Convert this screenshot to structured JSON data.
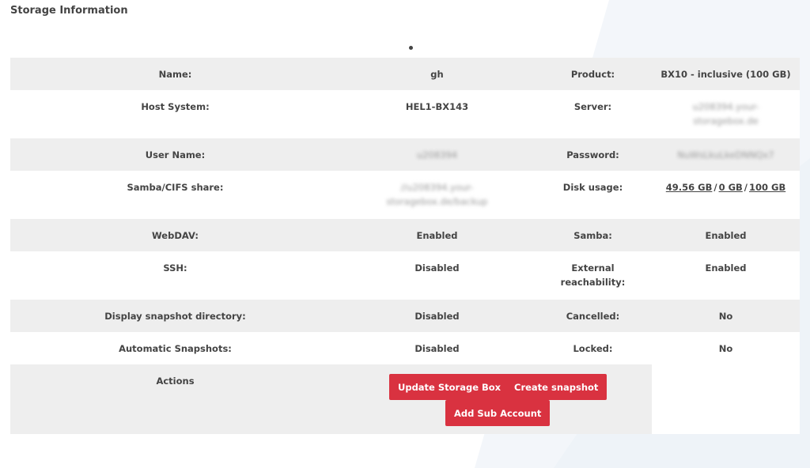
{
  "section_title": "Storage Information",
  "rows": [
    {
      "label1": "Name:",
      "value1": "gh",
      "label2": "Product:",
      "value2": "BX10 - inclusive (100 GB)"
    },
    {
      "label1": "Host System:",
      "value1": "HEL1-BX143",
      "label2": "Server:",
      "value2": "u208394.your-storagebox.de"
    },
    {
      "label1": "User Name:",
      "value1": "u208394",
      "label2": "Password:",
      "value2": "NuWsLkuLkeDNNQx7"
    },
    {
      "label1": "Samba/CIFS share:",
      "value1": "//u208394.your-storagebox.de/backup",
      "label2": "Disk usage:",
      "value2": ""
    },
    {
      "label1": "WebDAV:",
      "value1": "Enabled",
      "label2": "Samba:",
      "value2": "Enabled"
    },
    {
      "label1": "SSH:",
      "value1": "Disabled",
      "label2": "External reachability:",
      "value2": "Enabled"
    },
    {
      "label1": "Display snapshot directory:",
      "value1": "Disabled",
      "label2": "Cancelled:",
      "value2": "No"
    },
    {
      "label1": "Automatic Snapshots:",
      "value1": "Disabled",
      "label2": "Locked:",
      "value2": "No"
    }
  ],
  "disk_usage": {
    "used": "49.56 GB",
    "snapshots": "0 GB",
    "total": "100 GB",
    "separator": "/"
  },
  "actions": {
    "label": "Actions",
    "update_storage_box": "Update Storage Box",
    "create_snapshot": "Create snapshot",
    "add_sub_account": "Add Sub Account"
  },
  "colors": {
    "button": "#d93240",
    "row_shade": "#eeeeee"
  }
}
